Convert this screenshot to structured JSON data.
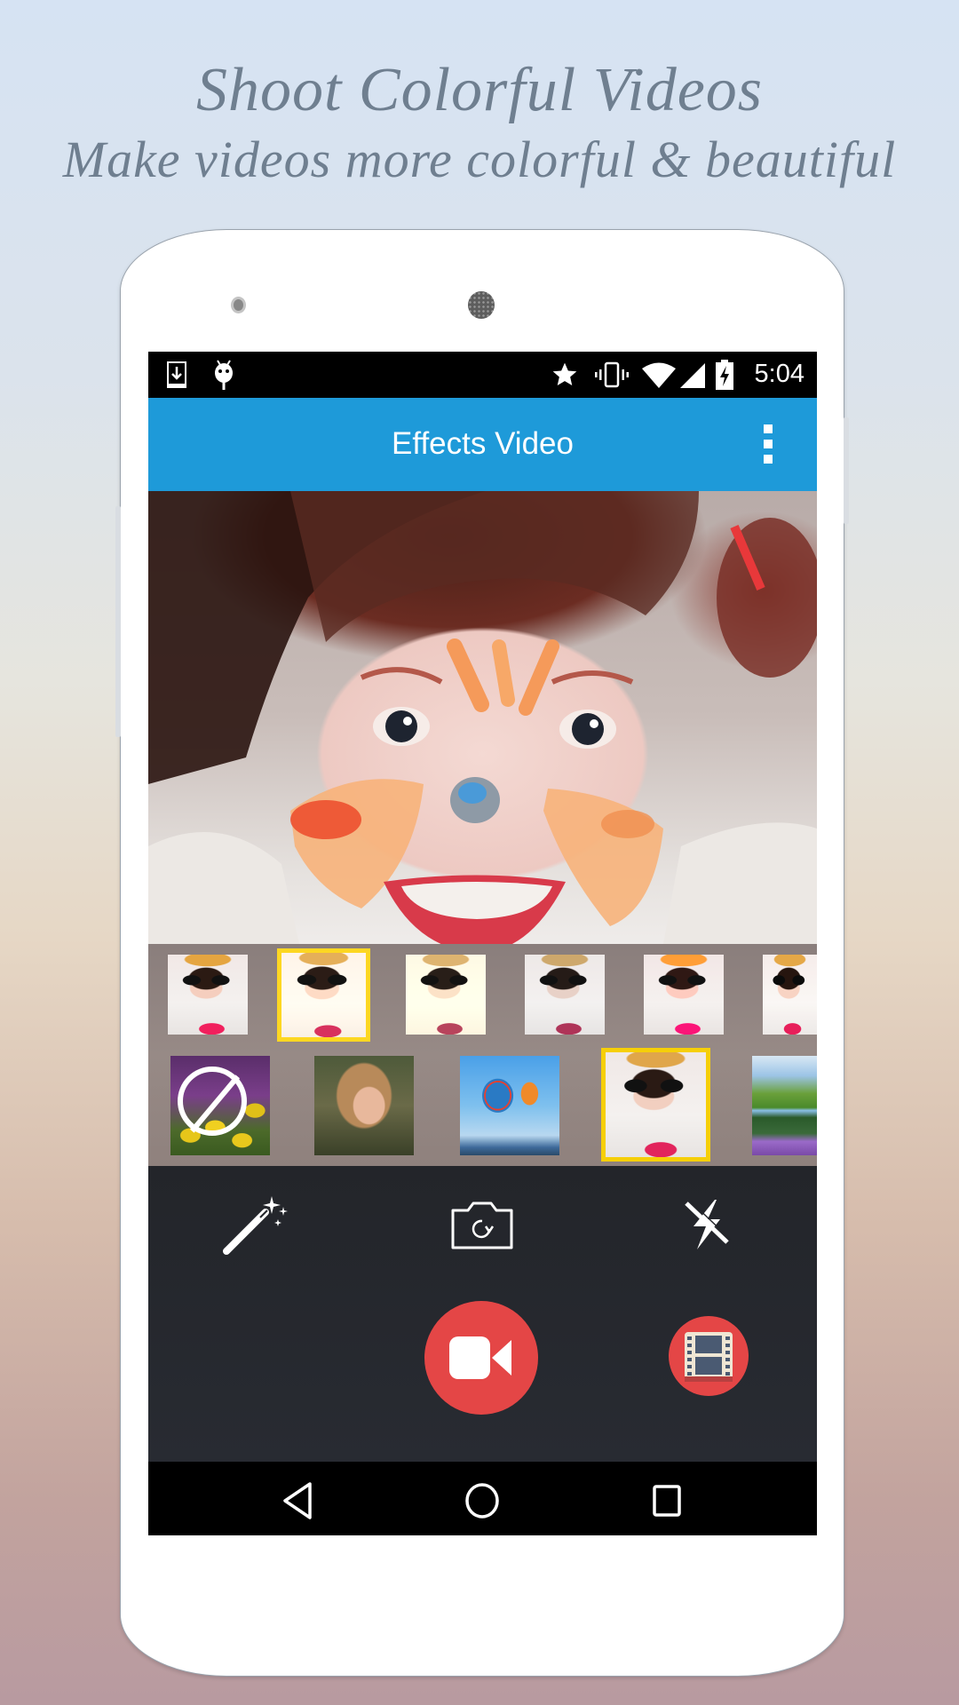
{
  "promo": {
    "title": "Shoot Colorful Videos",
    "subtitle": "Make videos more colorful & beautiful"
  },
  "status_bar": {
    "left_icons": [
      "download-icon",
      "android-debug-icon"
    ],
    "right_icons": [
      "star-icon",
      "vibrate-icon",
      "wifi-icon",
      "signal-icon",
      "battery-charging-icon"
    ],
    "time": "5:04"
  },
  "app_bar": {
    "title": "Effects Video",
    "menu_icon": "overflow-menu-icon",
    "color": "#1e9ad9"
  },
  "camera_preview": {
    "subject": "girl-with-face-paint"
  },
  "color_filters": {
    "items": [
      {
        "name": "filter-1",
        "selected": false
      },
      {
        "name": "filter-2",
        "selected": true
      },
      {
        "name": "filter-3",
        "selected": false
      },
      {
        "name": "filter-4",
        "selected": false
      },
      {
        "name": "filter-5",
        "selected": false
      },
      {
        "name": "filter-6",
        "selected": false
      }
    ]
  },
  "overlay_effects": {
    "items": [
      {
        "name": "none-tulips",
        "selected": false
      },
      {
        "name": "woman-portrait",
        "selected": false
      },
      {
        "name": "hot-air-balloons",
        "selected": false
      },
      {
        "name": "kid-portrait",
        "selected": true
      },
      {
        "name": "mountain-nature",
        "selected": false
      }
    ]
  },
  "controls": {
    "effects_icon": "magic-wand-icon",
    "switch_camera_icon": "camera-switch-icon",
    "flash_icon": "flash-off-icon",
    "record_icon": "video-camera-icon",
    "gallery_icon": "film-strip-icon",
    "accent": "#e44646",
    "selection_color": "#f6cf08"
  },
  "nav_bar": {
    "back": "back-icon",
    "home": "home-icon",
    "recents": "recents-icon"
  }
}
